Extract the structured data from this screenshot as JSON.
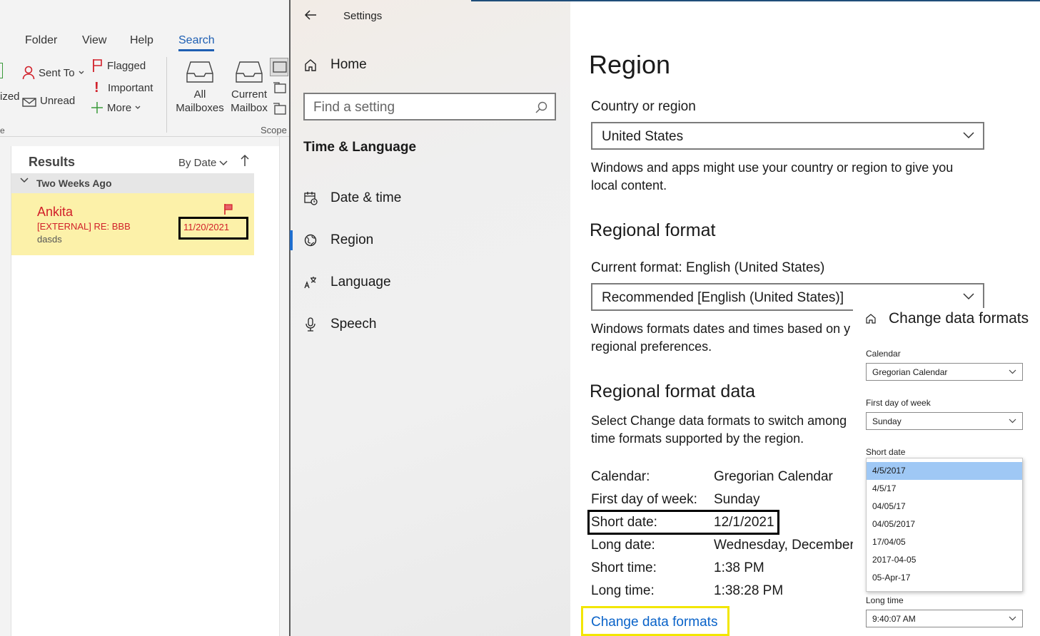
{
  "outlook": {
    "tabs": [
      "Folder",
      "View",
      "Help",
      "Search"
    ],
    "active_tab": "Search",
    "ribbon": {
      "partial_left_1": "ized",
      "partial_left_2": "e",
      "sent_to": "Sent To",
      "unread": "Unread",
      "flagged": "Flagged",
      "important": "Important",
      "more": "More",
      "all_mailboxes_1": "All",
      "all_mailboxes_2": "Mailboxes",
      "current_mailbox_1": "Current",
      "current_mailbox_2": "Mailbox",
      "scope_group": "Scope"
    },
    "results": {
      "title": "Results",
      "sort": "By Date",
      "group": "Two Weeks Ago",
      "item": {
        "sender": "Ankita",
        "subject": "[EXTERNAL] RE: BBB",
        "preview": "dasds",
        "date": "11/20/2021"
      }
    }
  },
  "settings": {
    "window_title": "Settings",
    "home": "Home",
    "search_placeholder": "Find a setting",
    "section": "Time & Language",
    "nav": [
      {
        "label": "Date & time",
        "icon": "calendar-clock-icon"
      },
      {
        "label": "Region",
        "icon": "globe-icon",
        "active": true
      },
      {
        "label": "Language",
        "icon": "language-icon"
      },
      {
        "label": "Speech",
        "icon": "microphone-icon"
      }
    ],
    "region": {
      "title": "Region",
      "country_label": "Country or region",
      "country_value": "United States",
      "country_desc_1": "Windows and apps might use your country or region to give you",
      "country_desc_2": "local content.",
      "regional_format_heading": "Regional format",
      "current_format": "Current format: English (United States)",
      "format_value": "Recommended [English (United States)]",
      "format_desc_1": "Windows formats dates and times based on y",
      "format_desc_2": "regional preferences.",
      "format_data_heading": "Regional format data",
      "format_data_desc_1": "Select Change data formats to switch among",
      "format_data_desc_2": "time formats supported by the region.",
      "rows": [
        {
          "k": "Calendar:",
          "v": "Gregorian Calendar"
        },
        {
          "k": "First day of week:",
          "v": "Sunday"
        },
        {
          "k": "Short date:",
          "v": "12/1/2021"
        },
        {
          "k": "Long date:",
          "v": "Wednesday, December '"
        },
        {
          "k": "Short time:",
          "v": "1:38 PM"
        },
        {
          "k": "Long time:",
          "v": "1:38:28 PM"
        }
      ],
      "change_link": "Change data formats"
    },
    "change_data_formats": {
      "title": "Change data formats",
      "calendar_label": "Calendar",
      "calendar_value": "Gregorian Calendar",
      "first_day_label": "First day of week",
      "first_day_value": "Sunday",
      "short_date_label": "Short date",
      "short_date_options": [
        "4/5/2017",
        "4/5/17",
        "04/05/17",
        "04/05/2017",
        "17/04/05",
        "2017-04-05",
        "05-Apr-17"
      ],
      "short_date_selected": "4/5/2017",
      "long_time_label": "Long time",
      "long_time_value": "9:40:07 AM"
    }
  },
  "colors": {
    "accent": "#1f6fcf",
    "link": "#0a63c9",
    "flag_red": "#d1202a",
    "mail_highlight": "#fcf1a9",
    "yellow_annotation": "#f2e600"
  }
}
